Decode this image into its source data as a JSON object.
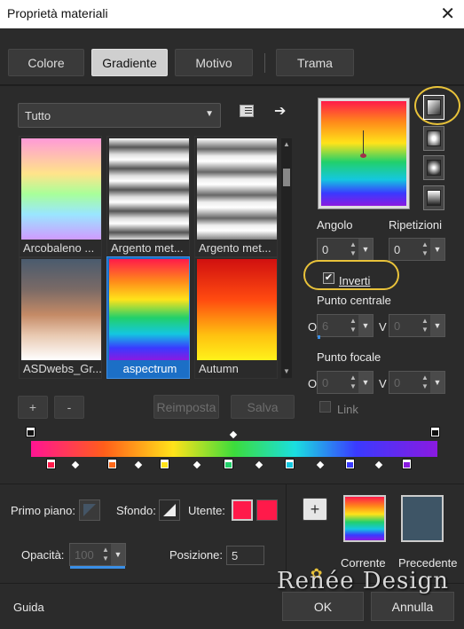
{
  "window": {
    "title": "Proprietà materiali",
    "close_glyph": "✕"
  },
  "tabs": [
    {
      "label": "Colore"
    },
    {
      "label": "Gradiente"
    },
    {
      "label": "Motivo"
    },
    {
      "label": "Trama"
    }
  ],
  "category": {
    "selected": "Tutto"
  },
  "gradients": [
    {
      "label": "Arcobaleno ..."
    },
    {
      "label": "Argento met..."
    },
    {
      "label": "Argento met..."
    },
    {
      "label": "ASDwebs_Gr..."
    },
    {
      "label": "aspectrum"
    },
    {
      "label": "Autumn"
    }
  ],
  "list_buttons": {
    "add": "+",
    "remove": "-",
    "reset": "Reimposta",
    "save": "Salva"
  },
  "angle": {
    "label": "Angolo",
    "value": "0"
  },
  "repeats": {
    "label": "Ripetizioni",
    "value": "0"
  },
  "invert": {
    "label": "Inverti",
    "checked": true
  },
  "center_point": {
    "label": "Punto centrale",
    "o_label": "O",
    "o_value": "6",
    "v_label": "V",
    "v_value": "0"
  },
  "focal_point": {
    "label": "Punto focale",
    "o_label": "O",
    "o_value": "0",
    "v_label": "V",
    "v_value": "0"
  },
  "link": {
    "label": "Link",
    "checked": false
  },
  "stops_colors": [
    "#ff1a4a",
    "#ff6a1a",
    "#ffe31a",
    "#22d06a",
    "#14c7e0",
    "#3a3aff",
    "#8a1ae0"
  ],
  "bottom": {
    "foreground_label": "Primo piano:",
    "background_label": "Sfondo:",
    "user_label": "Utente:",
    "user_color": "#ff1a4a",
    "opacity_label": "Opacità:",
    "opacity_value": "100",
    "position_label": "Posizione:",
    "position_value": "5",
    "add_glyph": "+",
    "current_label": "Corrente",
    "previous_label": "Precedente",
    "previous_color": "#3e5566"
  },
  "footer": {
    "help": "Guida",
    "ok": "OK",
    "cancel": "Annulla"
  },
  "watermark": "Renée Design"
}
